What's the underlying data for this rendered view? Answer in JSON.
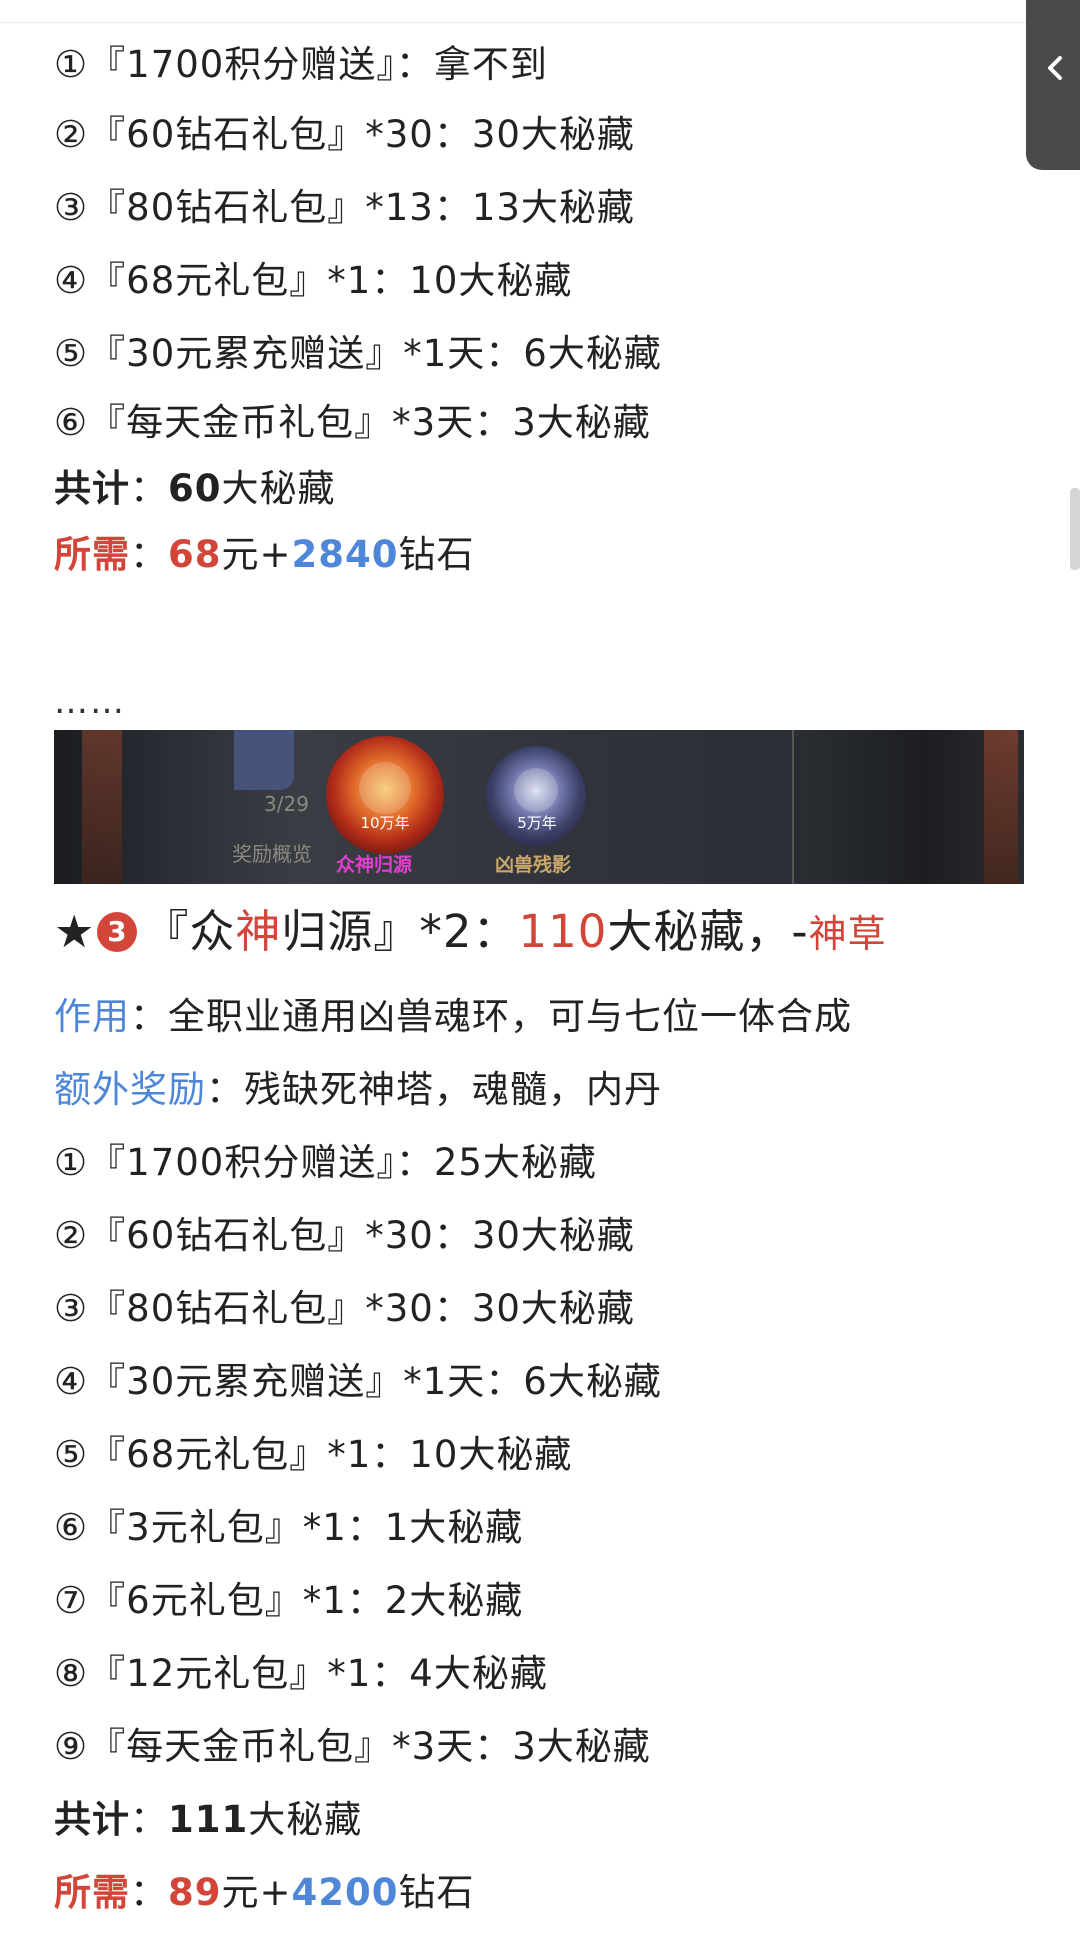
{
  "section_top": {
    "items": [
      {
        "num": "①",
        "name": "『1700积分赠送』",
        "sep": "：",
        "value": "拿不到"
      },
      {
        "num": "②",
        "name": "『60钻石礼包』*30",
        "sep": "：",
        "value": "30大秘藏"
      },
      {
        "num": "③",
        "name": "『80钻石礼包』*13",
        "sep": "：",
        "value": "13大秘藏"
      },
      {
        "num": "④",
        "name": "『68元礼包』*1",
        "sep": "：",
        "value": "10大秘藏"
      },
      {
        "num": "⑤",
        "name": "『30元累充赠送』*1天",
        "sep": "：",
        "value": "6大秘藏"
      },
      {
        "num": "⑥",
        "name": "『每天金币礼包』*3天",
        "sep": "：",
        "value": "3大秘藏"
      }
    ],
    "total_label": "共计",
    "total_sep": "：",
    "total_value": "60",
    "total_unit": "大秘藏",
    "cost_label": "所需",
    "cost_sep": "：",
    "cost_yuan": "68",
    "cost_yuan_unit": "元+",
    "cost_diamond": "2840",
    "cost_diamond_unit": "钻石"
  },
  "ellipsis": "……",
  "banner": {
    "left_faded_num": "3/29",
    "left_faded_label": "奖励概览",
    "orb1_tag": "10万年",
    "orb1_name": "众神归源",
    "orb2_tag": "5万年",
    "orb2_name": "凶兽残影",
    "orb1_name_color": "#e23fd0",
    "orb2_name_color": "#c9a86a"
  },
  "section_3": {
    "star": "★",
    "badge": "3",
    "title_open": "『众",
    "title_highlight": "神",
    "title_rest": "归源』*2：",
    "title_value": "110",
    "title_unit": "大秘藏，-",
    "title_extra": "神草",
    "effect_label": "作用",
    "effect_sep": "：",
    "effect_text": "全职业通用凶兽魂环，可与七位一体合成",
    "bonus_label": "额外奖励",
    "bonus_sep": "：",
    "bonus_text": "残缺死神塔，魂髓，内丹",
    "items": [
      {
        "num": "①",
        "name": "『1700积分赠送』",
        "sep": "：",
        "value": "25大秘藏"
      },
      {
        "num": "②",
        "name": "『60钻石礼包』*30",
        "sep": "：",
        "value": "30大秘藏"
      },
      {
        "num": "③",
        "name": "『80钻石礼包』*30",
        "sep": "：",
        "value": "30大秘藏"
      },
      {
        "num": "④",
        "name": "『30元累充赠送』*1天",
        "sep": "：",
        "value": "6大秘藏"
      },
      {
        "num": "⑤",
        "name": "『68元礼包』*1",
        "sep": "：",
        "value": "10大秘藏"
      },
      {
        "num": "⑥",
        "name": "『3元礼包』*1",
        "sep": "：",
        "value": "1大秘藏"
      },
      {
        "num": "⑦",
        "name": "『6元礼包』*1",
        "sep": "：",
        "value": "2大秘藏"
      },
      {
        "num": "⑧",
        "name": "『12元礼包』*1",
        "sep": "：",
        "value": "4大秘藏"
      },
      {
        "num": "⑨",
        "name": "『每天金币礼包』*3天",
        "sep": "：",
        "value": "3大秘藏"
      }
    ],
    "total_label": "共计",
    "total_sep": "：",
    "total_value": "111",
    "total_unit": "大秘藏",
    "cost_label": "所需",
    "cost_sep": "：",
    "cost_yuan": "89",
    "cost_yuan_unit": "元+",
    "cost_diamond": "4200",
    "cost_diamond_unit": "钻石"
  },
  "side_tab": {
    "icon": "chevron-left-icon"
  },
  "colors": {
    "red": "#d2463a",
    "blue": "#4f87d8",
    "tab_bg": "#4a4a4c"
  }
}
